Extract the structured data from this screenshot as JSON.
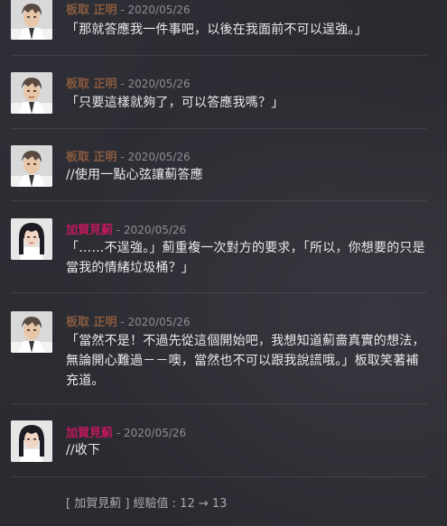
{
  "colors": {
    "name_itadori": "#8a5a3e",
    "name_kaga": "#c2185b",
    "date": "#8d8d93",
    "text": "#eaeaea"
  },
  "messages": [
    {
      "author": "板取 正明",
      "sep": " - ",
      "date": "2020/05/26",
      "text": "「那就答應我一件事吧，以後在我面前不可以逞強。」",
      "avatar": "male-avatar"
    },
    {
      "author": "板取 正明",
      "sep": " - ",
      "date": "2020/05/26",
      "text": "「只要這樣就夠了，可以答應我嗎？」",
      "avatar": "male-avatar"
    },
    {
      "author": "板取 正明",
      "sep": " - ",
      "date": "2020/05/26",
      "text": "//使用一點心弦讓薊答應",
      "avatar": "male-avatar"
    },
    {
      "author": "加賀見薊",
      "sep": " - ",
      "date": "2020/05/26",
      "text": "「……不逞強。」薊重複一次對方的要求，「所以，你想要的只是當我的情緒垃圾桶？」",
      "avatar": "female-avatar"
    },
    {
      "author": "板取 正明",
      "sep": " - ",
      "date": "2020/05/26",
      "text": "「當然不是！不過先從這個開始吧，我想知道薊嗇真實的想法，無論開心難過－－噢，當然也不可以跟我說謊哦。」板取笑著補充道。",
      "avatar": "male-avatar"
    },
    {
      "author": "加賀見薊",
      "sep": " - ",
      "date": "2020/05/26",
      "text": "//收下",
      "avatar": "female-avatar"
    }
  ],
  "footer": {
    "text": "[ 加賀見薊 ] 經驗值 : 12 → 13"
  }
}
